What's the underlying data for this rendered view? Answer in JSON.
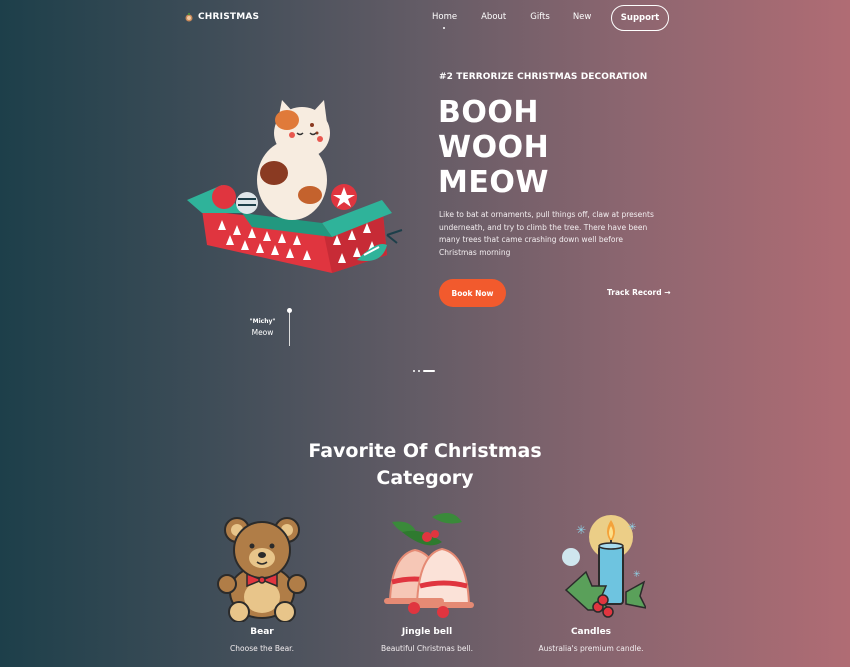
{
  "nav": {
    "brand": "CHRISTMAS",
    "links": [
      "Home",
      "About",
      "Gifts",
      "New"
    ],
    "support": "Support"
  },
  "hero": {
    "eyebrow": "#2 TERRORIZE CHRISTMAS DECORATION",
    "title_lines": [
      "BOOH",
      "WOOH",
      "MEOW"
    ],
    "description": "Like to bat at ornaments, pull things off, claw at presents underneath, and try to climb the tree. There have been many trees that came crashing down well before Christmas morning",
    "book_label": "Book Now",
    "track_label": "Track Record →",
    "quote_name": "\"Michy\"",
    "quote_sub": "Meow"
  },
  "section": {
    "title_lines": [
      "Favorite Of Christmas",
      "Category"
    ]
  },
  "categories": [
    {
      "name": "Bear",
      "desc": "Choose the Bear.",
      "icon": "teddy-bear-icon"
    },
    {
      "name": "Jingle bell",
      "desc": "Beautiful Christmas bell.",
      "icon": "jingle-bell-icon"
    },
    {
      "name": "Candles",
      "desc": "Australia's premium candle.",
      "icon": "candle-icon"
    }
  ],
  "colors": {
    "accent": "#f25a2d",
    "gradient_start": "#1d3f4a",
    "gradient_end": "#b06c74"
  }
}
